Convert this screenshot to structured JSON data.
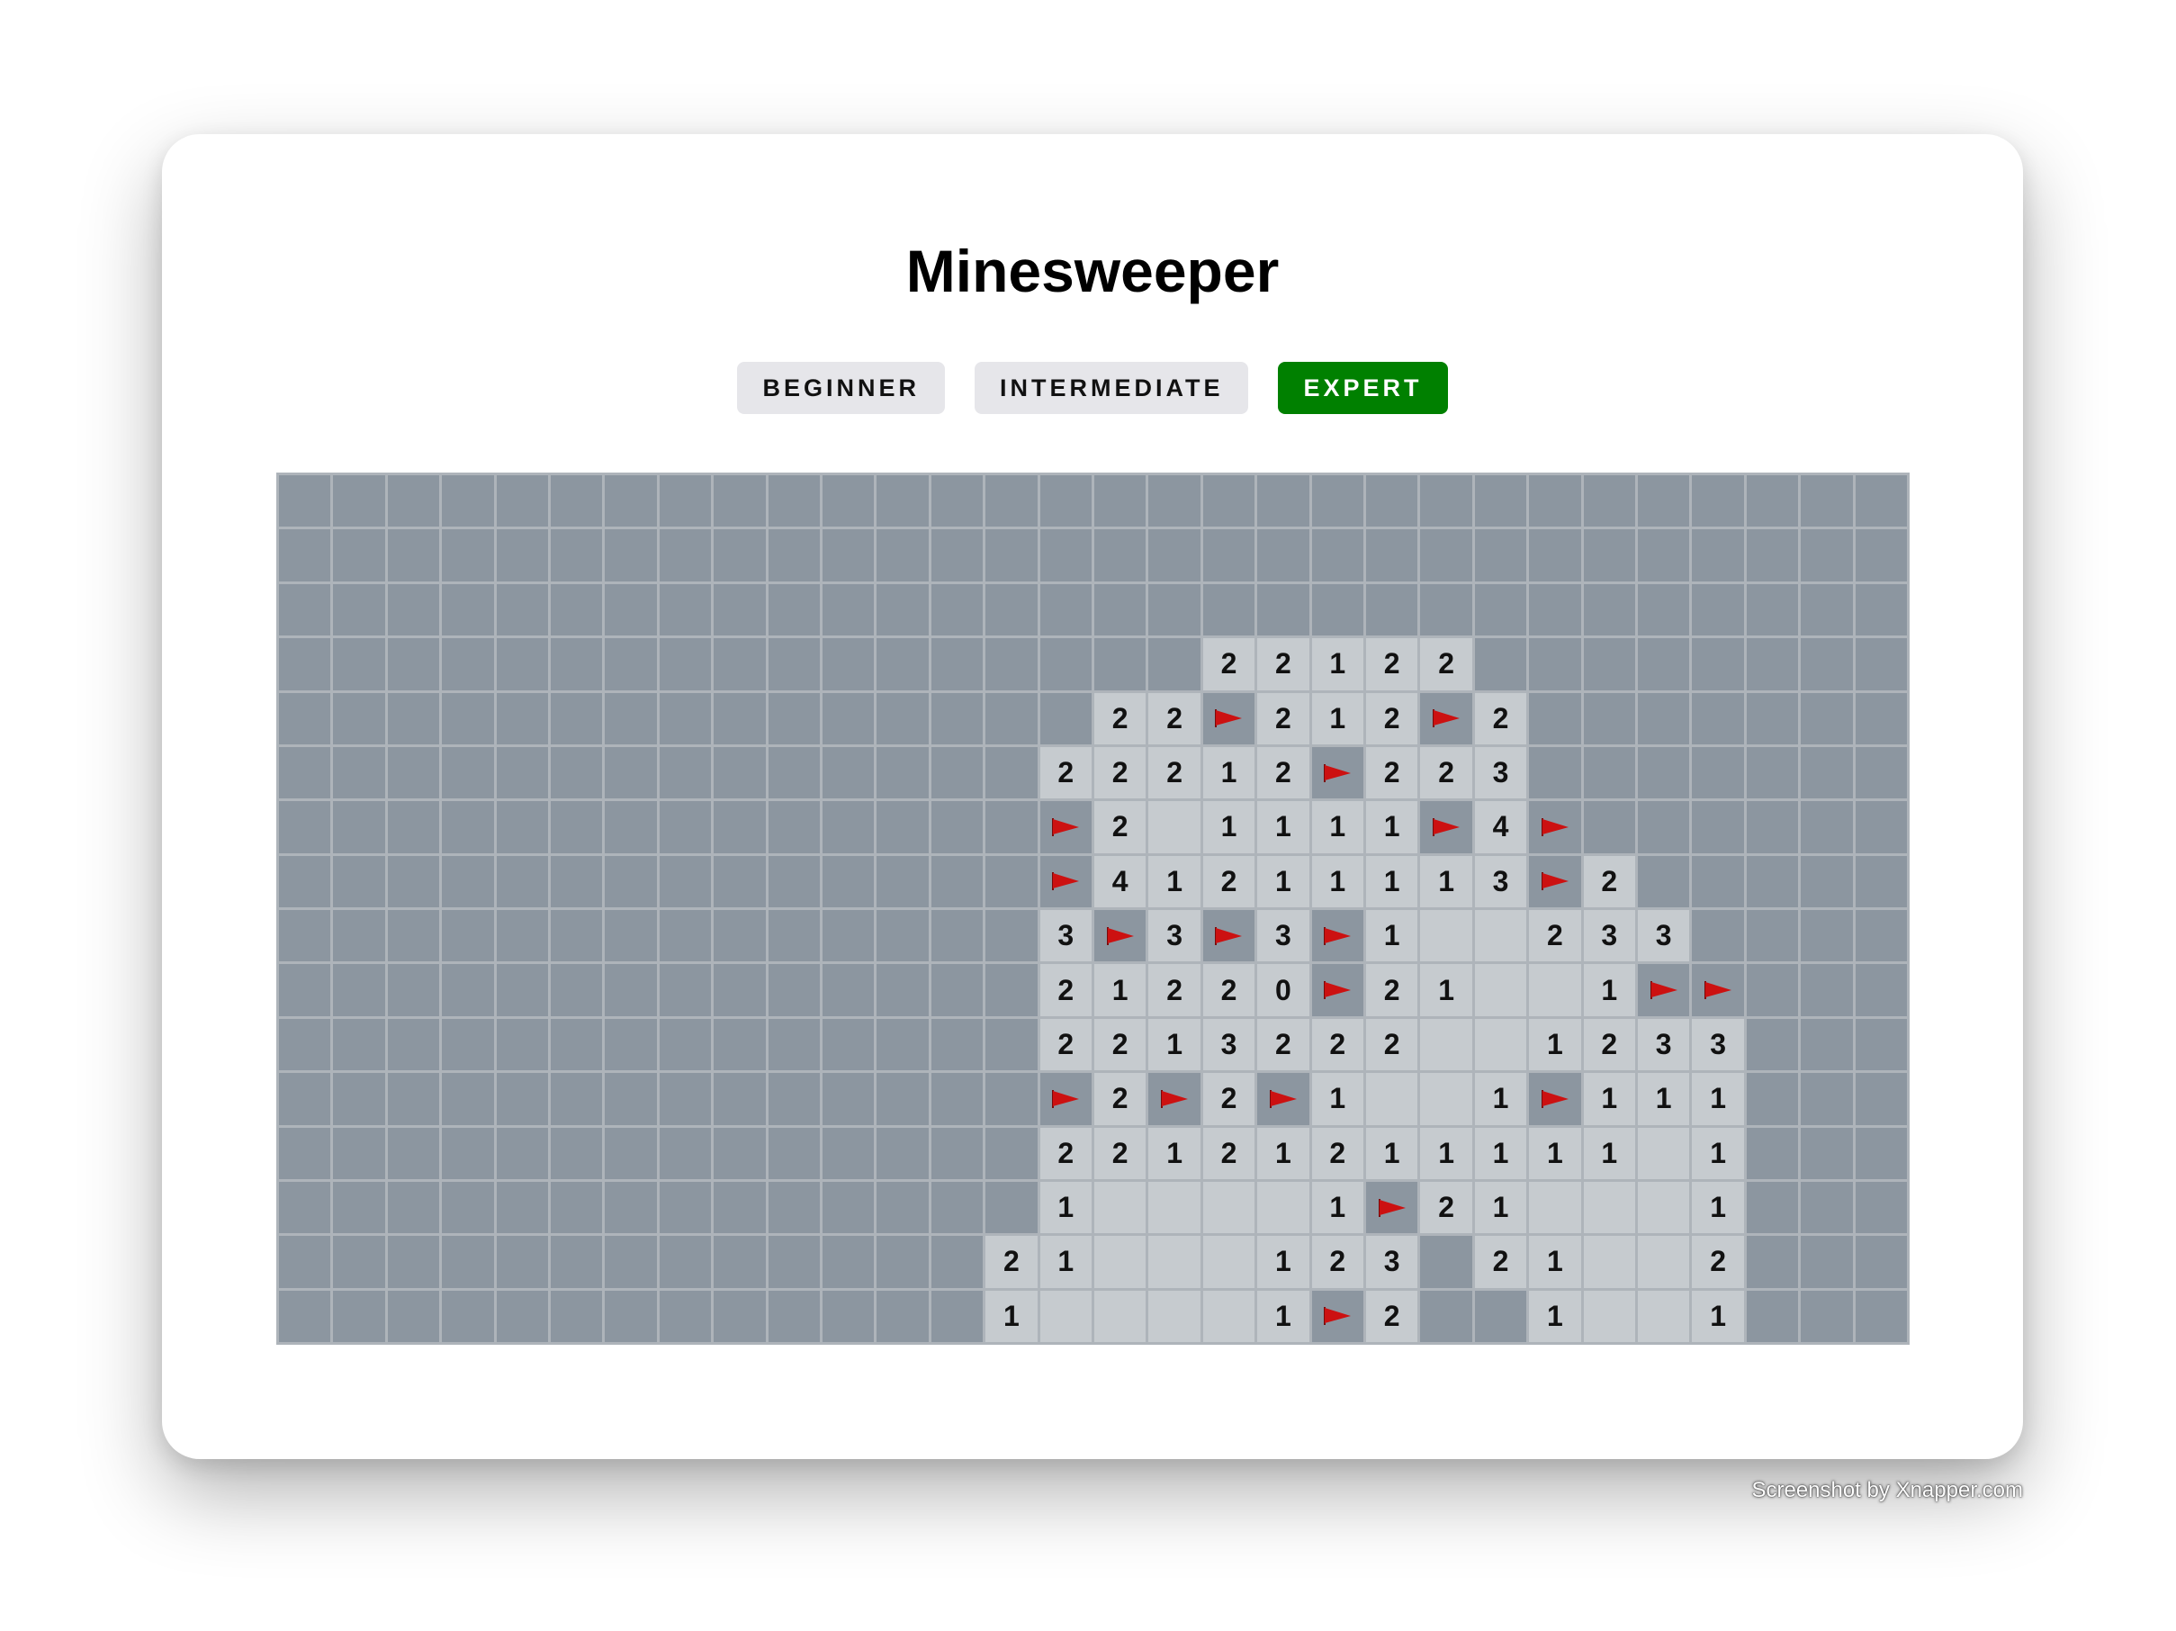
{
  "title": "Minesweeper",
  "levels": [
    {
      "label": "BEGINNER",
      "active": false
    },
    {
      "label": "INTERMEDIATE",
      "active": false
    },
    {
      "label": "EXPERT",
      "active": true
    }
  ],
  "colors": {
    "active_level": "#008000",
    "hidden_cell": "#8c96a0",
    "open_cell": "#c6cbcf",
    "flag": "#cc1111"
  },
  "board": {
    "cols": 30,
    "rows": 16,
    "legend": {
      "#": "hidden",
      ".": "open-empty",
      "F": "flag",
      "1-8": "open-number"
    },
    "grid": [
      "##############################",
      "##############################",
      "##############################",
      "#################22122#########",
      "###############22F212F2########",
      "##############22212F223#######",
      "##############F2.1111F4F######",
      "##############F41211113F2#####",
      "##############3F3F3F1..233#####",
      "##############21220F21..1FF#####",
      "##############2213 22..1233####",
      "##############F2F2F1..1F111###",
      "##############22121211111.1###",
      "##############1....1F21...1###",
      "#############21...123#21..2###",
      "#############1....1F2##1..1###"
    ]
  },
  "watermark": "Screenshot by Xnapper.com"
}
